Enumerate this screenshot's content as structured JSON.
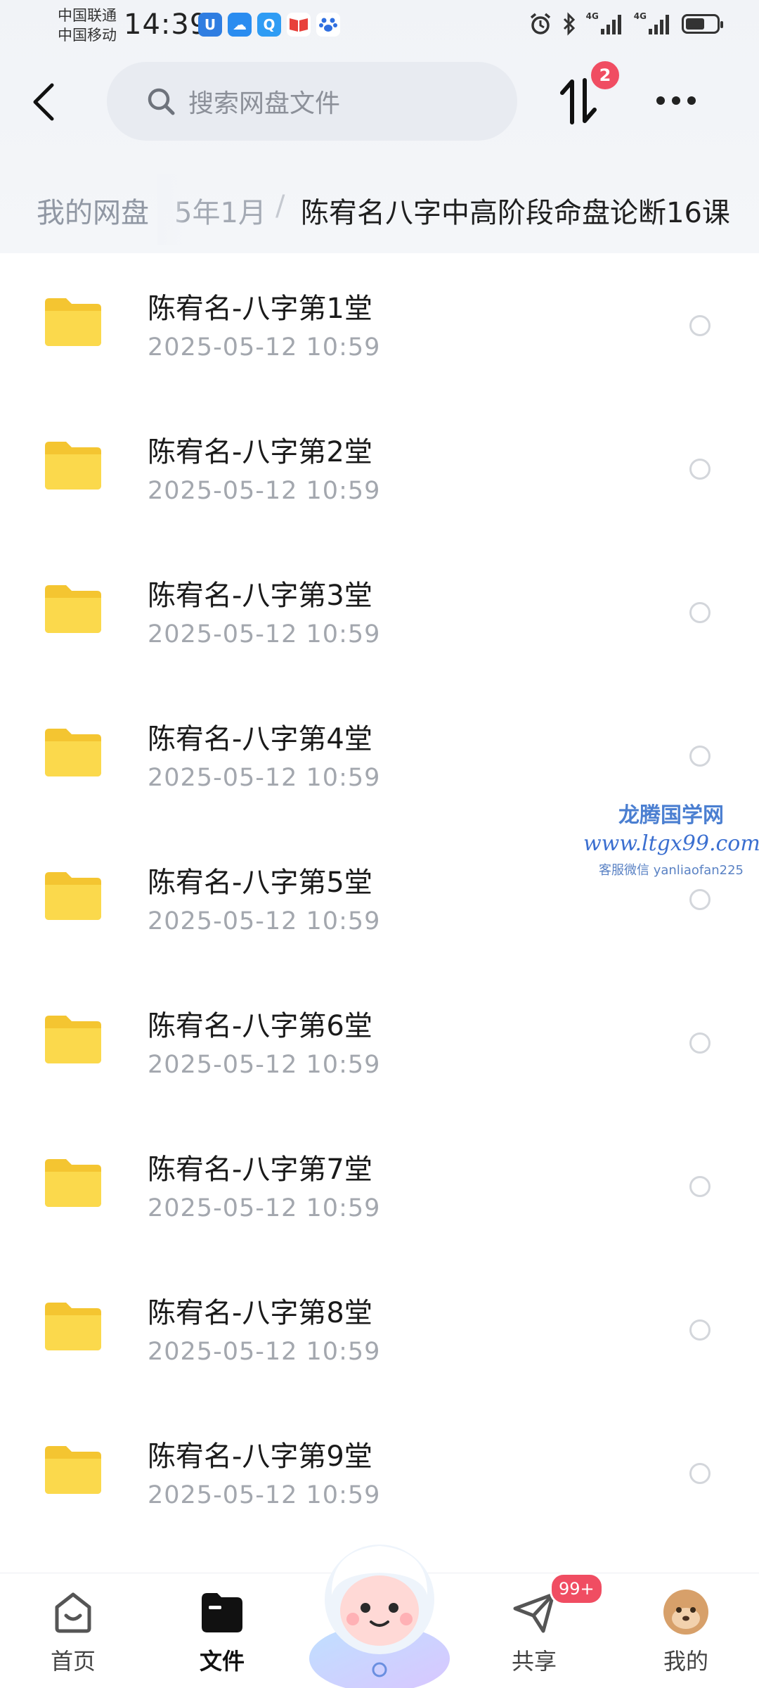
{
  "status_bar": {
    "carrier_1": "中国联通",
    "carrier_2": "中国移动",
    "time": "14:39",
    "network_1": "4G",
    "network_2": "4G",
    "app_icons": [
      "shield-app-icon",
      "cloud-app-icon",
      "search-app-icon",
      "book-app-icon",
      "paw-app-icon"
    ]
  },
  "header": {
    "search_placeholder": "搜索网盘文件",
    "transfer_badge": "2"
  },
  "breadcrumb": {
    "root": "我的网盘",
    "parent_fragment": "5年1月",
    "separator": "/",
    "current": "陈宥名八字中高阶段命盘论断16课"
  },
  "files": [
    {
      "name": "陈宥名-八字第1堂",
      "date": "2025-05-12  10:59"
    },
    {
      "name": "陈宥名-八字第2堂",
      "date": "2025-05-12  10:59"
    },
    {
      "name": "陈宥名-八字第3堂",
      "date": "2025-05-12  10:59"
    },
    {
      "name": "陈宥名-八字第4堂",
      "date": "2025-05-12  10:59"
    },
    {
      "name": "陈宥名-八字第5堂",
      "date": "2025-05-12  10:59"
    },
    {
      "name": "陈宥名-八字第6堂",
      "date": "2025-05-12  10:59"
    },
    {
      "name": "陈宥名-八字第7堂",
      "date": "2025-05-12  10:59"
    },
    {
      "name": "陈宥名-八字第8堂",
      "date": "2025-05-12  10:59"
    },
    {
      "name": "陈宥名-八字第9堂",
      "date": "2025-05-12  10:59"
    }
  ],
  "watermark": {
    "title": "龙腾国学网",
    "url": "www.ltgx99.com",
    "contact": "客服微信 yanliaofan225"
  },
  "bottom_nav": {
    "home": "首页",
    "files": "文件",
    "share": "共享",
    "share_badge": "99+",
    "mine": "我的"
  },
  "colors": {
    "folder": "#f8cf3c",
    "badge": "#f04d62",
    "secondary_text": "#a3a7ae"
  }
}
